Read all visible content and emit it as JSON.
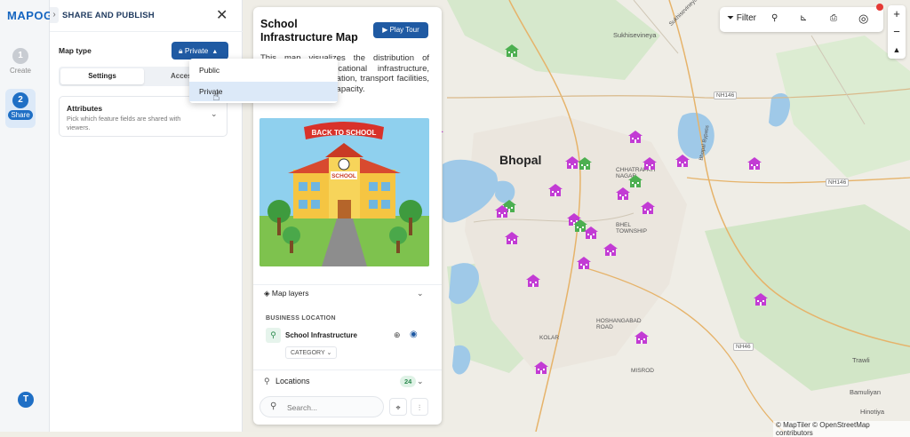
{
  "app": {
    "logo": "MAPOG"
  },
  "rail": {
    "steps": [
      {
        "num": "1",
        "label": "Create"
      },
      {
        "num": "2",
        "label": "Share"
      }
    ],
    "avatar": "T"
  },
  "share_panel": {
    "title": "SHARE AND PUBLISH",
    "map_type_label": "Map type",
    "privacy_value": "Private",
    "tabs": [
      "Settings",
      "Access"
    ],
    "attributes_title": "Attributes",
    "attributes_desc": "Pick which feature fields are shared with viewers."
  },
  "dropdown": {
    "options": [
      "Public",
      "Private"
    ],
    "selected": "Private"
  },
  "card": {
    "title": "School Infrastructure Map",
    "tour_label": "Play Tour",
    "desc_visible": "This map visualizes the distribution of schools and educational infrastructure, including board affiliation, transport facilities, sports and student capacity.",
    "illustration_banner": "BACK TO SCHOOL",
    "illustration_sign": "SCHOOL",
    "layers_label": "Map layers",
    "business_location_label": "BUSINESS LOCATION",
    "layer_name": "School Infrastructure",
    "category_label": "CATEGORY",
    "locations_label": "Locations",
    "locations_count": "24",
    "search_placeholder": "Search..."
  },
  "toolbar": {
    "filter_label": "Filter"
  },
  "map": {
    "city": "Bhopal",
    "labels": [
      "Sukhisevineya",
      "NH146",
      "NH146",
      "NH46",
      "Bhopal Bypass",
      "Sukhisevineya",
      "CHHATRAPATI NAGAR",
      "BHEL TOWNSHIP",
      "HOSHANGABAD ROAD",
      "KOLAR",
      "MISROD",
      "Trawli",
      "Bamuliyan",
      "Hinotiya"
    ],
    "attribution": "© MapTiler © OpenStreetMap contributors"
  },
  "colors": {
    "accent": "#1f5aa3",
    "marker_pink": "#c23bd4",
    "marker_green": "#4caf50",
    "water": "#9fc9e8",
    "park": "#cfe3c4"
  }
}
